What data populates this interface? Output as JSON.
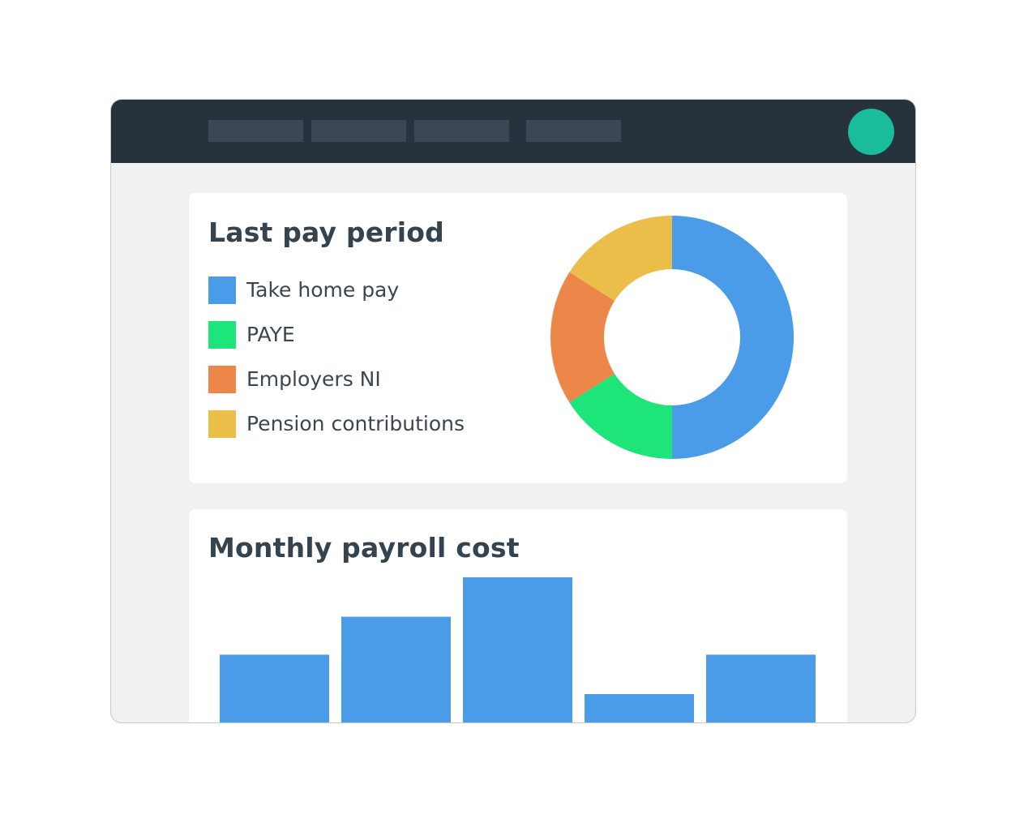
{
  "nav": {
    "tabs": [
      {
        "label": ""
      },
      {
        "label": ""
      },
      {
        "label": ""
      },
      {
        "label": ""
      }
    ]
  },
  "colors": {
    "topbar": "#26323c",
    "nav_tab": "#3b4853",
    "avatar": "#1abc9c",
    "bar": "#4a9be8",
    "take_home_pay": "#4a9be8",
    "paye": "#1de579",
    "employers_ni": "#ed8649",
    "pension_contributions": "#ebbd49"
  },
  "last_pay_period": {
    "title": "Last pay period",
    "legend": [
      {
        "label": "Take home pay",
        "color": "#4a9be8"
      },
      {
        "label": "PAYE",
        "color": "#1de579"
      },
      {
        "label": "Employers NI",
        "color": "#ed8649"
      },
      {
        "label": "Pension contributions",
        "color": "#ebbd49"
      }
    ]
  },
  "monthly_payroll_cost": {
    "title": "Monthly payroll cost"
  },
  "chart_data": [
    {
      "type": "pie",
      "title": "Last pay period",
      "donut": true,
      "categories": [
        "Take home pay",
        "PAYE",
        "Employers NI",
        "Pension contributions"
      ],
      "values": [
        50,
        16,
        18,
        16
      ],
      "colors": [
        "#4a9be8",
        "#1de579",
        "#ed8649",
        "#ebbd49"
      ],
      "legend_position": "left"
    },
    {
      "type": "bar",
      "title": "Monthly payroll cost",
      "categories": [
        "",
        "",
        "",
        "",
        ""
      ],
      "values": [
        47,
        73,
        100,
        20,
        47
      ],
      "ylim": [
        0,
        100
      ],
      "grid": false
    }
  ]
}
